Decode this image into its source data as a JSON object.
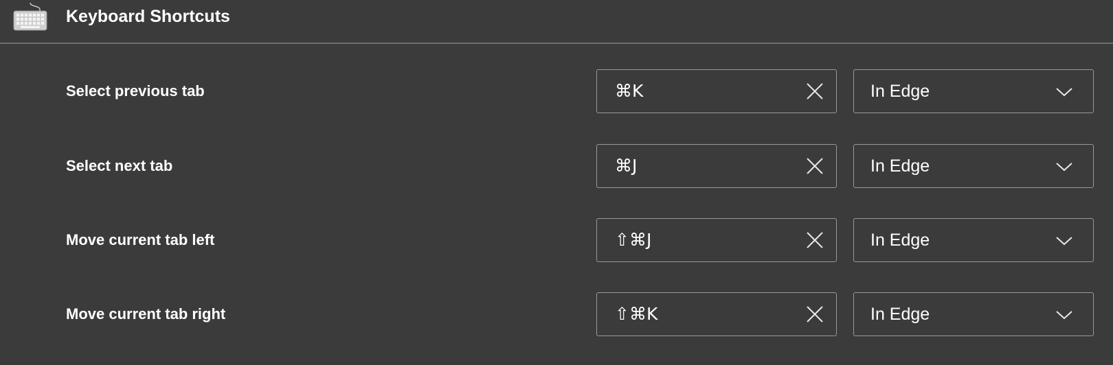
{
  "header": {
    "icon": "keyboard-icon",
    "title": "Keyboard Shortcuts"
  },
  "shortcuts": [
    {
      "label": "Select previous tab",
      "keys": "⌘K",
      "scope": "In Edge"
    },
    {
      "label": "Select next tab",
      "keys": "⌘J",
      "scope": "In Edge"
    },
    {
      "label": "Move current tab left",
      "keys": "⇧⌘J",
      "scope": "In Edge"
    },
    {
      "label": "Move current tab right",
      "keys": "⇧⌘K",
      "scope": "In Edge"
    }
  ],
  "icons": {
    "clear": "close-icon",
    "dropdown": "chevron-down-icon"
  },
  "colors": {
    "background": "#3b3b3b",
    "text": "#ffffff",
    "border": "#9a9a9a",
    "divider": "#6e6e6e"
  }
}
